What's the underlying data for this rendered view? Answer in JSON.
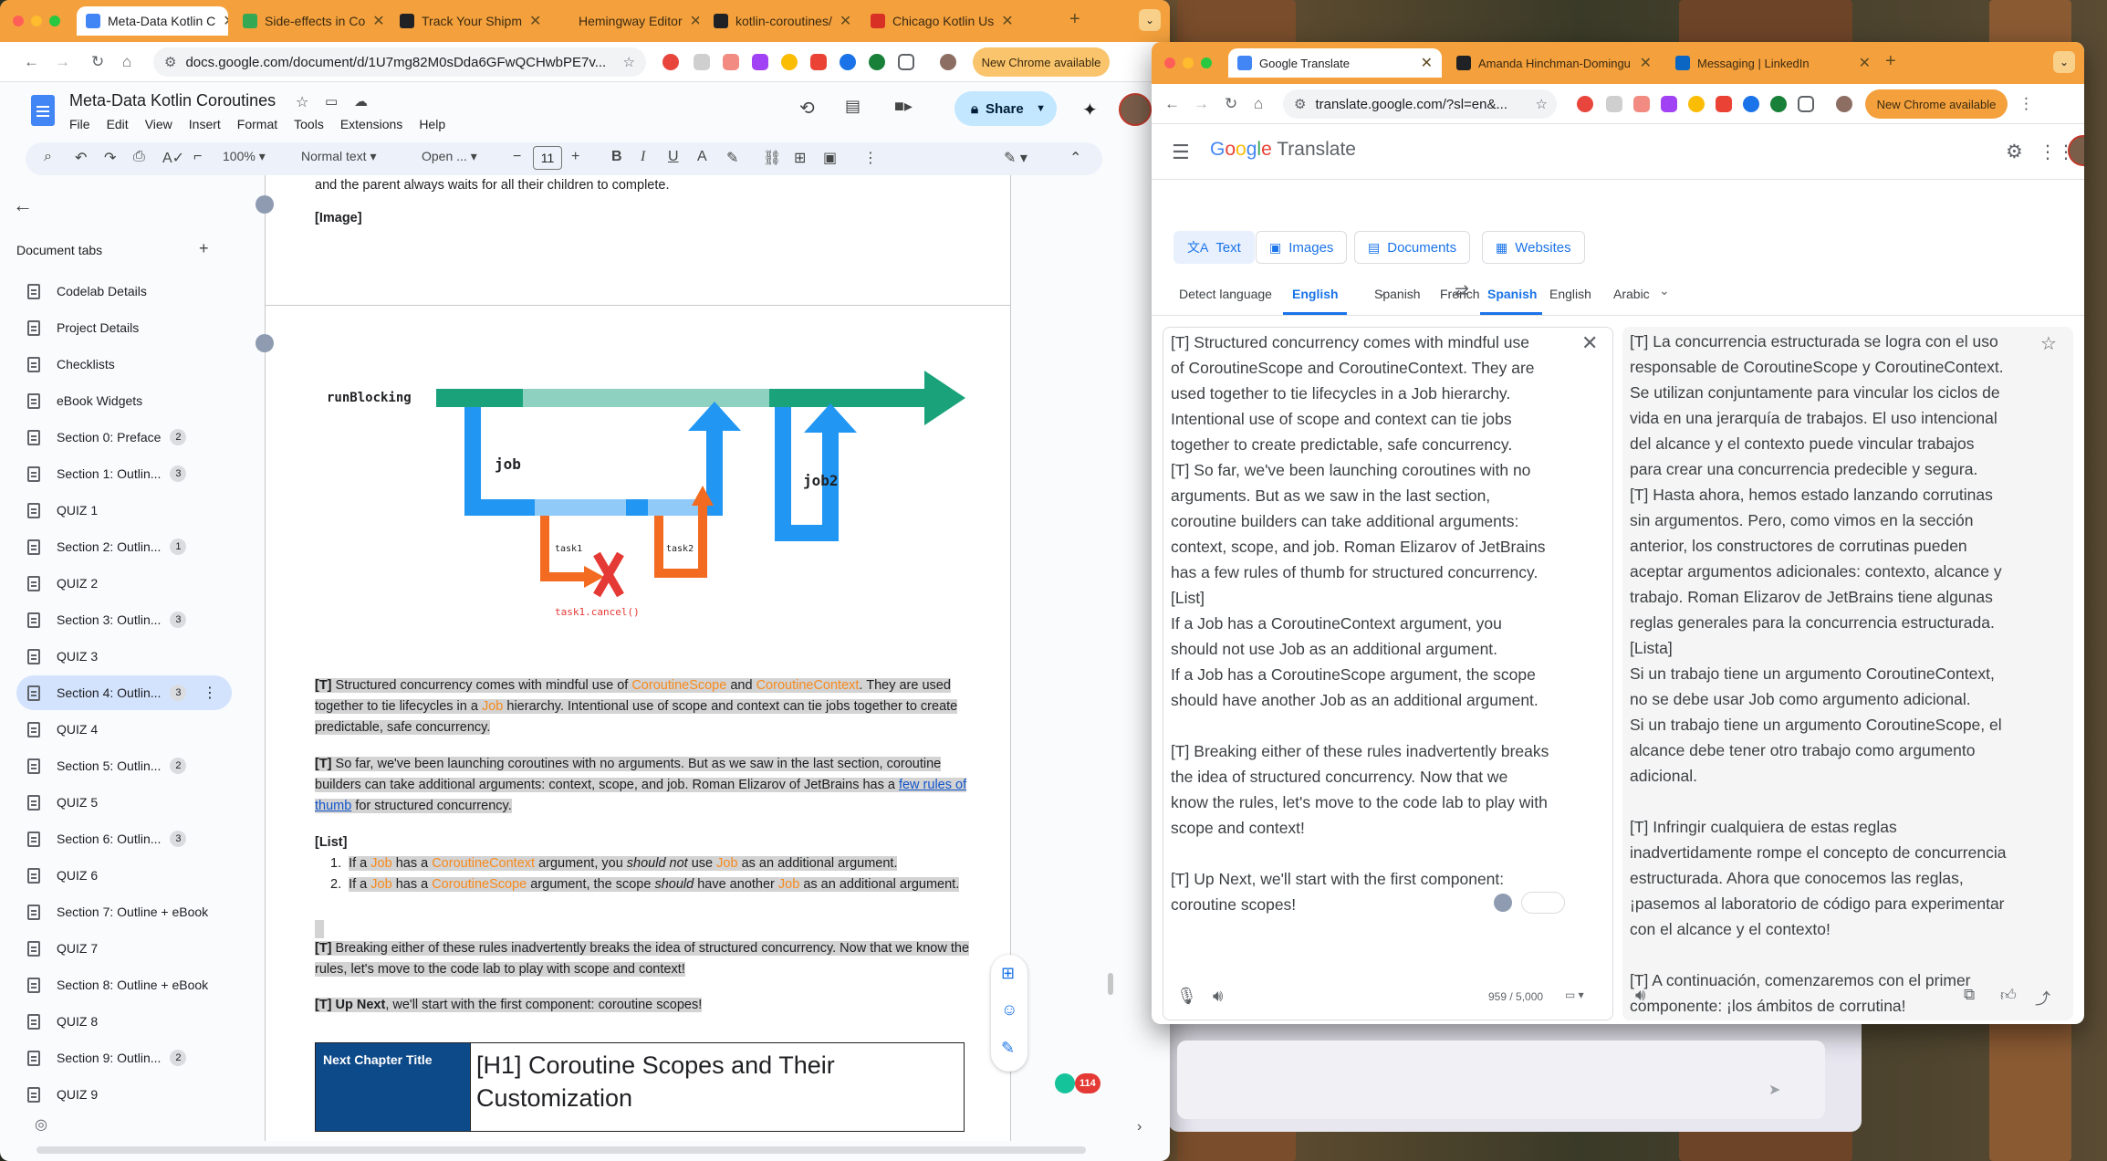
{
  "docs_window": {
    "tabs": [
      {
        "label": "Meta-Data Kotlin C",
        "color": "#4285f4"
      },
      {
        "label": "Side-effects in Co",
        "color": "#34a853"
      },
      {
        "label": "Track Your Shipm",
        "color": "#202124"
      },
      {
        "label": "Hemingway Editor",
        "color": "#f4a13d"
      },
      {
        "label": "kotlin-coroutines/",
        "color": "#202124"
      },
      {
        "label": "Chicago Kotlin Us",
        "color": "#d93025"
      }
    ],
    "url": "docs.google.com/document/d/1U7mg82M0sDda6GFwQCHwbPE7v...",
    "new_chrome": "New Chrome available",
    "doc_title": "Meta-Data Kotlin Coroutines",
    "menu": [
      "File",
      "Edit",
      "View",
      "Insert",
      "Format",
      "Tools",
      "Extensions",
      "Help"
    ],
    "share_label": "Share",
    "toolbar": {
      "zoom": "100%",
      "style": "Normal text",
      "font": "Open ...",
      "font_size": "11"
    },
    "sidebar": {
      "header": "Document tabs",
      "items": [
        {
          "label": "Codelab Details",
          "badge": ""
        },
        {
          "label": "Project Details",
          "badge": ""
        },
        {
          "label": "Checklists",
          "badge": ""
        },
        {
          "label": "eBook Widgets",
          "badge": ""
        },
        {
          "label": "Section 0: Preface",
          "badge": "2"
        },
        {
          "label": "Section 1: Outlin...",
          "badge": "3"
        },
        {
          "label": "QUIZ 1",
          "badge": ""
        },
        {
          "label": "Section 2: Outlin...",
          "badge": "1"
        },
        {
          "label": "QUIZ 2",
          "badge": ""
        },
        {
          "label": "Section 3: Outlin...",
          "badge": "3"
        },
        {
          "label": "QUIZ 3",
          "badge": ""
        },
        {
          "label": "Section 4: Outlin...",
          "badge": "3",
          "selected": true
        },
        {
          "label": "QUIZ 4",
          "badge": ""
        },
        {
          "label": "Section 5: Outlin...",
          "badge": "2"
        },
        {
          "label": "QUIZ 5",
          "badge": ""
        },
        {
          "label": "Section 6: Outlin...",
          "badge": "3"
        },
        {
          "label": "QUIZ 6",
          "badge": ""
        },
        {
          "label": "Section 7: Outline + eBook",
          "badge": ""
        },
        {
          "label": "QUIZ 7",
          "badge": ""
        },
        {
          "label": "Section 8: Outline + eBook",
          "badge": ""
        },
        {
          "label": "QUIZ 8",
          "badge": ""
        },
        {
          "label": "Section 9: Outlin...",
          "badge": "2"
        },
        {
          "label": "QUIZ 9",
          "badge": ""
        }
      ]
    },
    "page1": {
      "line": "and the parent always waits for all their children to complete.",
      "image": "[Image]"
    },
    "diagram": {
      "run": "runBlocking",
      "job": "job",
      "job2": "job2",
      "task1": "task1",
      "task2": "task2",
      "cancel": "task1.cancel()"
    },
    "body": {
      "p1_tag": "[T]",
      "p1_a": " Structured concurrency comes with mindful use of ",
      "p1_b": "CoroutineScope",
      "p1_c": " and ",
      "p1_d": "CoroutineContext",
      "p1_e": ". They are used together to tie lifecycles in a ",
      "p1_f": "Job",
      "p1_g": " hierarchy. Intentional use of scope and context can tie jobs together to create predictable, safe concurrency.",
      "p2_tag": "[T]",
      "p2_a": " So far, we've been launching coroutines with no arguments. But as we saw in the last section, coroutine builders can take additional arguments: context, scope, and job. Roman Elizarov of JetBrains has a ",
      "p2_link": "few rules of thumb",
      "p2_b": " for structured concurrency.",
      "list_tag": "[List]",
      "li1_a": "If a ",
      "li1_b": "Job",
      "li1_c": " has a ",
      "li1_d": "CoroutineContext",
      "li1_e": " argument, you ",
      "li1_f": "should not",
      "li1_g": " use ",
      "li1_h": "Job",
      "li1_i": " as an additional argument.",
      "li2_a": "If a ",
      "li2_b": "Job",
      "li2_c": " has a ",
      "li2_d": "CoroutineScope",
      "li2_e": " argument, the scope ",
      "li2_f": "should",
      "li2_g": " have another ",
      "li2_h": "Job",
      "li2_i": " as an additional argument.",
      "p3_tag": "[T]",
      "p3": " Breaking either of these rules inadvertently breaks the idea of structured concurrency. Now that we know the rules, let's move to the code lab to play with scope and context!",
      "p4_tag": "[T] Up Next",
      "p4": ", we'll start with the first component: coroutine scopes!",
      "table_label": "Next Chapter Title",
      "table_value": "[H1] Coroutine Scopes and Their Customization"
    },
    "notif_count": "114"
  },
  "translate_window": {
    "tabs": [
      {
        "label": "Google Translate",
        "color": "#4285f4"
      },
      {
        "label": "Amanda Hinchman-Domingu",
        "color": "#202124"
      },
      {
        "label": "Messaging | LinkedIn",
        "color": "#0a66c2"
      }
    ],
    "url": "translate.google.com/?sl=en&...",
    "new_chrome": "New Chrome available",
    "logo": "Google Translate",
    "modes": [
      "Text",
      "Images",
      "Documents",
      "Websites"
    ],
    "source_langs": [
      "Detect language",
      "English",
      "Spanish",
      "French"
    ],
    "target_langs": [
      "Spanish",
      "English",
      "Arabic"
    ],
    "source_text": "[T] Structured concurrency comes with mindful use\nof CoroutineScope and CoroutineContext. They are\nused together to tie lifecycles in a Job hierarchy.\nIntentional use of scope and context can tie jobs\ntogether to create predictable, safe concurrency.\n[T] So far, we've been launching coroutines with no\narguments. But as we saw in the last section,\ncoroutine builders can take additional arguments:\ncontext, scope, and job. Roman Elizarov of JetBrains\nhas a few rules of thumb for structured concurrency.\n[List]\nIf a Job has a CoroutineContext argument, you\nshould not use Job as an additional argument.\nIf a Job has a CoroutineScope argument, the scope\nshould have another Job as an additional argument.\n\n[T] Breaking either of these rules inadvertently breaks\nthe idea of structured concurrency. Now that we\nknow the rules, let's move to the code lab to play with\nscope and context!\n\n[T] Up Next, we'll start with the first component:\ncoroutine scopes!",
    "target_text": "[T] La concurrencia estructurada se logra con el uso\nresponsable de CoroutineScope y CoroutineContext.\nSe utilizan conjuntamente para vincular los ciclos de\nvida en una jerarquía de trabajos. El uso intencional\ndel alcance y el contexto puede vincular trabajos\npara crear una concurrencia predecible y segura.\n[T] Hasta ahora, hemos estado lanzando corrutinas\nsin argumentos. Pero, como vimos en la sección\nanterior, los constructores de corrutinas pueden\naceptar argumentos adicionales: contexto, alcance y\ntrabajo. Roman Elizarov de JetBrains tiene algunas\nreglas generales para la concurrencia estructurada.\n[Lista]\nSi un trabajo tiene un argumento CoroutineContext,\nno se debe usar Job como argumento adicional.\nSi un trabajo tiene un argumento CoroutineScope, el\nalcance debe tener otro trabajo como argumento\nadicional.\n\n[T] Infringir cualquiera de estas reglas\ninadvertidamente rompe el concepto de concurrencia\nestructurada. Ahora que conocemos las reglas,\n¡pasemos al laboratorio de código para experimentar\ncon el alcance y el contexto!\n\n[T] A continuación, comenzaremos con el primer\ncomponente: ¡los ámbitos de corrutina!",
    "char_count": "959 / 5,000"
  },
  "colors": {
    "chrome_orange": "#f4a13d",
    "blue": "#1a73e8",
    "orange_text": "#f78a1e",
    "table_header": "#0d4a8a"
  }
}
